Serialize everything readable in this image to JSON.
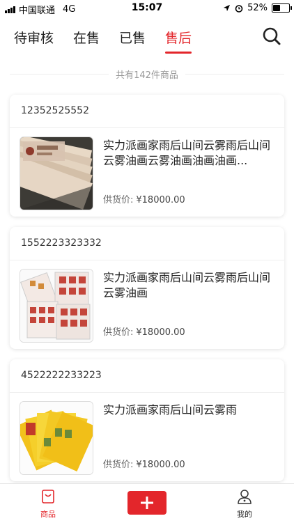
{
  "status_bar": {
    "carrier": "中国联通",
    "network": "4G",
    "time": "15:07",
    "battery": "52%",
    "battery_level": 0.52
  },
  "tabs": [
    {
      "label": "待审核",
      "active": false
    },
    {
      "label": "在售",
      "active": false
    },
    {
      "label": "已售",
      "active": false
    },
    {
      "label": "售后",
      "active": true
    }
  ],
  "summary": {
    "count_text": "共有142件商品"
  },
  "items": [
    {
      "id": "12352525552",
      "title": "实力派画家雨后山间云雾雨后山间云雾油画云雾油画油画油画...",
      "price_label": "供货价:",
      "price": "¥18000.00",
      "image": "banknote-stack"
    },
    {
      "id": "1552223323332",
      "title": "实力派画家雨后山间云雾雨后山间云雾油画",
      "price_label": "供货价:",
      "price": "¥18000.00",
      "image": "stamp-sheets"
    },
    {
      "id": "4522222233223",
      "title": "实力派画家雨后山间云雾雨",
      "price_label": "供货价:",
      "price": "¥18000.00",
      "image": "yellow-cards"
    }
  ],
  "bottom_nav": {
    "goods_label": "商品",
    "mine_label": "我的",
    "icons": {
      "goods": "shopping-bag-icon",
      "add": "plus-icon",
      "mine": "user-icon"
    }
  },
  "colors": {
    "accent": "#e3262b",
    "muted": "#999999"
  }
}
